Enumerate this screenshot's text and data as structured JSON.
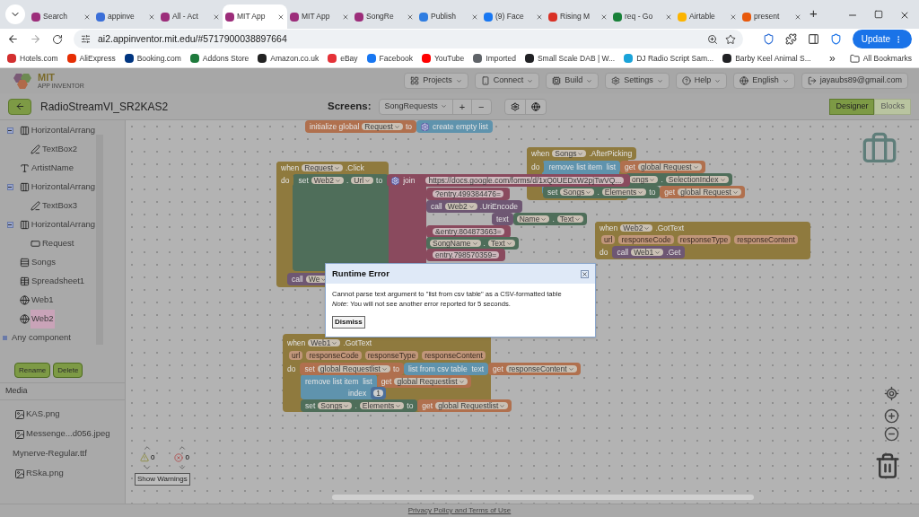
{
  "browser": {
    "tabs": [
      {
        "title": "Search",
        "selected": false,
        "color": "#9c2d7a"
      },
      {
        "title": "appinve",
        "selected": false,
        "color": "#3b6fd8"
      },
      {
        "title": "All - Act",
        "selected": false,
        "color": "#9c2d7a"
      },
      {
        "title": "MIT App",
        "selected": true,
        "color": "#9c2d7a"
      },
      {
        "title": "MIT App",
        "selected": false,
        "color": "#9c2d7a"
      },
      {
        "title": "SongRe",
        "selected": false,
        "color": "#9c2d7a"
      },
      {
        "title": "Publish",
        "selected": false,
        "color": "#2f7de1"
      },
      {
        "title": "(9) Face",
        "selected": false,
        "color": "#1877f2"
      },
      {
        "title": "Rising M",
        "selected": false,
        "color": "#d93025"
      },
      {
        "title": "req - Go",
        "selected": false,
        "color": "#188038"
      },
      {
        "title": "Airtable",
        "selected": false,
        "color": "#fcb400"
      },
      {
        "title": "present",
        "selected": false,
        "color": "#e8590c"
      }
    ],
    "new_tab": "+",
    "address": "ai2.appinventor.mit.edu/#5717900038897664",
    "update_button": "Update",
    "bookmarks": [
      {
        "label": "Hotels.com",
        "color": "#d32f2f"
      },
      {
        "label": "AliExpress",
        "color": "#e62e04"
      },
      {
        "label": "Booking.com",
        "color": "#003580"
      },
      {
        "label": "Addons Store",
        "color": "#1e7a3c"
      },
      {
        "label": "Amazon.co.uk",
        "color": "#222222"
      },
      {
        "label": "eBay",
        "color": "#e53238"
      },
      {
        "label": "Facebook",
        "color": "#1877f2"
      },
      {
        "label": "YouTube",
        "color": "#ff0000"
      },
      {
        "label": "Imported",
        "color": "#5f6368"
      },
      {
        "label": "Small Scale DAB | W...",
        "color": "#202124"
      },
      {
        "label": "DJ Radio Script Sam...",
        "color": "#1aa3d9"
      },
      {
        "label": "Barby Keel Animal S...",
        "color": "#202124"
      }
    ],
    "more": "»",
    "all_bookmarks": "All Bookmarks"
  },
  "app": {
    "logo_title": "MIT",
    "logo_subtitle": "APP INVENTOR",
    "menus": [
      "Projects",
      "Connect",
      "Build",
      "Settings",
      "Help",
      "English",
      "jayaubs89@gmail.com"
    ],
    "project_name": "RadioStreamVI_SR2KAS2",
    "screens_label": "Screens:",
    "screen": "SongRequests",
    "add_screen": "+",
    "remove_screen": "−",
    "views": [
      {
        "label": "Designer",
        "selected": true
      },
      {
        "label": "Blocks",
        "selected": false
      }
    ]
  },
  "components": {
    "items": [
      {
        "label": "HorizontalArrang",
        "kind": "arrangement",
        "expanded": true,
        "selected": false,
        "children": [
          {
            "label": "TextBox2",
            "kind": "textbox",
            "selected": false
          }
        ]
      },
      {
        "label": "ArtistName",
        "kind": "label",
        "selected": false
      },
      {
        "label": "HorizontalArrang",
        "kind": "arrangement",
        "expanded": true,
        "selected": false,
        "children": [
          {
            "label": "TextBox3",
            "kind": "textbox",
            "selected": false
          }
        ]
      },
      {
        "label": "HorizontalArrang",
        "kind": "arrangement",
        "expanded": true,
        "selected": false,
        "children": [
          {
            "label": "Request",
            "kind": "button",
            "selected": false
          }
        ]
      },
      {
        "label": "Songs",
        "kind": "listpicker",
        "selected": false
      },
      {
        "label": "Spreadsheet1",
        "kind": "spreadsheet",
        "selected": false
      },
      {
        "label": "Web1",
        "kind": "web",
        "selected": false
      },
      {
        "label": "Web2",
        "kind": "web",
        "selected": true
      }
    ],
    "any_component": "Any component",
    "buttons": [
      "Rename",
      "Delete"
    ]
  },
  "media": {
    "title": "Media",
    "files": [
      {
        "name": "KAS.png",
        "kind": "image"
      },
      {
        "name": "Messenge...d056.jpeg",
        "kind": "image"
      },
      {
        "name": "Mynerve-Regular.ttf",
        "kind": "font"
      },
      {
        "name": "RSka.png",
        "kind": "image"
      }
    ]
  },
  "blocks": [
    {
      "lines": [
        {
          "kind": "code",
          "segments": [
            {
              "color": "#b0704e",
              "parts": [
                {
                  "kind": "kw",
                  "text": "initialize global"
                },
                {
                  "kind": "dd",
                  "text": "Request"
                },
                {
                  "kind": "kw",
                  "text": "to"
                }
              ]
            },
            {
              "color": "#5f93ad",
              "parts": [
                {
                  "kind": "gear"
                },
                {
                  "kind": "kw",
                  "text": "create empty list"
                }
              ]
            }
          ]
        }
      ]
    },
    {
      "lines": [
        {
          "kind": "code",
          "segments": [
            {
              "color": "#8f7a3e",
              "parts": [
                {
                  "kind": "kw",
                  "text": "when"
                },
                {
                  "kind": "dd",
                  "text": "Request"
                },
                {
                  "kind": "kw",
                  "text": ".Click"
                }
              ]
            }
          ]
        },
        {
          "kind": "code",
          "segments": [
            {
              "color": "#8f7a3e",
              "parts": [
                {
                  "kind": "kw",
                  "text": "do"
                }
              ]
            },
            {
              "color": "#4f6e5a",
              "parts": [
                {
                  "kind": "kw",
                  "text": "set"
                },
                {
                  "kind": "dd",
                  "text": "Web2"
                },
                {
                  "kind": "kw",
                  "text": "."
                },
                {
                  "kind": "dd",
                  "text": "Url"
                },
                {
                  "kind": "kw",
                  "text": "to"
                }
              ]
            },
            {
              "color": "#8a4a5e",
              "parts": [
                {
                  "kind": "gear"
                },
                {
                  "kind": "kw",
                  "text": "join"
                }
              ]
            },
            {
              "color": "#8a4a5e",
              "parts": [
                {
                  "kind": "lit",
                  "text": "https://docs.google.com/forms/d/1xQ0UEDxW2pjTwVQ..."
                }
              ]
            }
          ]
        },
        {
          "kind": "code",
          "segments": [
            {
              "color": "#8a4a5e",
              "parts": [
                {
                  "kind": "lit",
                  "text": "?entry.499384476="
                }
              ]
            }
          ]
        },
        {
          "kind": "code",
          "segments": [
            {
              "color": "#6e5773",
              "parts": [
                {
                  "kind": "kw",
                  "text": "call"
                },
                {
                  "kind": "dd",
                  "text": "Web2"
                },
                {
                  "kind": "kw",
                  "text": ".UriEncode"
                }
              ]
            }
          ]
        },
        {
          "kind": "code",
          "segments": [
            {
              "color": "#6e5773",
              "parts": [
                {
                  "kind": "kw",
                  "text": "text"
                }
              ]
            },
            {
              "color": "#4f6e5a",
              "parts": [
                {
                  "kind": "dd",
                  "text": "Name"
                },
                {
                  "kind": "kw",
                  "text": "."
                },
                {
                  "kind": "dd",
                  "text": "Text"
                }
              ]
            }
          ]
        },
        {
          "kind": "code",
          "segments": [
            {
              "color": "#8a4a5e",
              "parts": [
                {
                  "kind": "lit",
                  "text": "&entry.804873663="
                }
              ]
            }
          ]
        },
        {
          "kind": "code",
          "segments": [
            {
              "color": "#4f6e5a",
              "parts": [
                {
                  "kind": "dd",
                  "text": "SongName"
                },
                {
                  "kind": "kw",
                  "text": "."
                },
                {
                  "kind": "dd",
                  "text": "Text"
                }
              ]
            }
          ]
        },
        {
          "kind": "code",
          "segments": [
            {
              "color": "#8a4a5e",
              "parts": [
                {
                  "kind": "lit",
                  "text": "entry.798570359="
                }
              ]
            }
          ]
        },
        {
          "kind": "code",
          "segments": [
            {
              "color": "#6e5773",
              "parts": [
                {
                  "kind": "kw",
                  "text": "call"
                },
                {
                  "kind": "dd",
                  "text": "We"
                }
              ]
            }
          ]
        }
      ]
    },
    {
      "lines": [
        {
          "kind": "code",
          "segments": [
            {
              "color": "#8f7a3e",
              "parts": [
                {
                  "kind": "kw",
                  "text": "when"
                },
                {
                  "kind": "dd",
                  "text": "Songs"
                },
                {
                  "kind": "kw",
                  "text": ".AfterPicking"
                }
              ]
            }
          ]
        },
        {
          "kind": "code",
          "segments": [
            {
              "color": "#8f7a3e",
              "parts": [
                {
                  "kind": "kw",
                  "text": "do"
                }
              ]
            },
            {
              "color": "#5f93ad",
              "parts": [
                {
                  "kind": "kw",
                  "text": "remove list item  list"
                }
              ]
            },
            {
              "color": "#b0704e",
              "parts": [
                {
                  "kind": "kw",
                  "text": "get"
                },
                {
                  "kind": "dd",
                  "text": "global Request"
                }
              ]
            }
          ]
        },
        {
          "kind": "code",
          "segments": [
            {
              "color": "#4f6e5a",
              "parts": [
                {
                  "kind": "dd",
                  "text": "ongs"
                },
                {
                  "kind": "kw",
                  "text": "."
                },
                {
                  "kind": "dd",
                  "text": "SelectionIndex"
                }
              ]
            }
          ]
        },
        {
          "kind": "code",
          "segments": [
            {
              "color": "#4f6e5a",
              "parts": [
                {
                  "kind": "kw",
                  "text": "set"
                },
                {
                  "kind": "dd",
                  "text": "Songs"
                },
                {
                  "kind": "kw",
                  "text": "."
                },
                {
                  "kind": "dd",
                  "text": "Elements"
                },
                {
                  "kind": "kw",
                  "text": "to"
                }
              ]
            },
            {
              "color": "#b0704e",
              "parts": [
                {
                  "kind": "kw",
                  "text": "get"
                },
                {
                  "kind": "dd",
                  "text": "global Request"
                }
              ]
            }
          ]
        }
      ]
    },
    {
      "lines": [
        {
          "kind": "code",
          "segments": [
            {
              "color": "#8f7a3e",
              "parts": [
                {
                  "kind": "kw",
                  "text": "when"
                },
                {
                  "kind": "dd",
                  "text": "Web2"
                },
                {
                  "kind": "kw",
                  "text": ".GotText"
                }
              ]
            }
          ]
        },
        {
          "kind": "params",
          "params": [
            "url",
            "responseCode",
            "responseType",
            "responseContent"
          ]
        },
        {
          "kind": "code",
          "segments": [
            {
              "color": "#8f7a3e",
              "parts": [
                {
                  "kind": "kw",
                  "text": "do"
                }
              ]
            },
            {
              "color": "#6e5773",
              "parts": [
                {
                  "kind": "kw",
                  "text": "call"
                },
                {
                  "kind": "dd",
                  "text": "Web1"
                },
                {
                  "kind": "kw",
                  "text": ".Get"
                }
              ]
            }
          ]
        }
      ]
    },
    {
      "lines": [
        {
          "kind": "code",
          "segments": [
            {
              "color": "#8f7a3e",
              "parts": [
                {
                  "kind": "kw",
                  "text": "when"
                },
                {
                  "kind": "dd",
                  "text": "Web1"
                },
                {
                  "kind": "kw",
                  "text": ".GotText"
                }
              ]
            }
          ]
        },
        {
          "kind": "params",
          "params": [
            "url",
            "responseCode",
            "responseType",
            "responseContent"
          ]
        },
        {
          "kind": "code",
          "segments": [
            {
              "color": "#8f7a3e",
              "parts": [
                {
                  "kind": "kw",
                  "text": "do"
                }
              ]
            },
            {
              "color": "#b0704e",
              "parts": [
                {
                  "kind": "kw",
                  "text": "set"
                },
                {
                  "kind": "dd",
                  "text": "global Requestlist"
                },
                {
                  "kind": "kw",
                  "text": "to"
                }
              ]
            },
            {
              "color": "#5f93ad",
              "parts": [
                {
                  "kind": "kw",
                  "text": "list from csv table  text"
                }
              ]
            },
            {
              "color": "#b0704e",
              "parts": [
                {
                  "kind": "kw",
                  "text": "get"
                },
                {
                  "kind": "dd",
                  "text": "responseContent"
                }
              ]
            }
          ]
        },
        {
          "kind": "code",
          "segments": [
            {
              "color": "#5f93ad",
              "parts": [
                {
                  "kind": "kw",
                  "text": "remove list item  list"
                }
              ]
            },
            {
              "color": "#b0704e",
              "parts": [
                {
                  "kind": "kw",
                  "text": "get"
                },
                {
                  "kind": "dd",
                  "text": "global Requestlist"
                }
              ]
            }
          ]
        },
        {
          "kind": "code",
          "segments": [
            {
              "color": "#5f93ad",
              "parts": [
                {
                  "kind": "kw",
                  "text": "index"
                }
              ]
            },
            {
              "color": "#4c6f9a",
              "parts": [
                {
                  "kind": "num",
                  "text": "1"
                }
              ]
            }
          ]
        },
        {
          "kind": "code",
          "segments": [
            {
              "color": "#4f6e5a",
              "parts": [
                {
                  "kind": "kw",
                  "text": "set"
                },
                {
                  "kind": "dd",
                  "text": "Songs"
                },
                {
                  "kind": "kw",
                  "text": "."
                },
                {
                  "kind": "dd",
                  "text": "Elements"
                },
                {
                  "kind": "kw",
                  "text": "to"
                }
              ]
            },
            {
              "color": "#b0704e",
              "parts": [
                {
                  "kind": "kw",
                  "text": "get"
                },
                {
                  "kind": "dd",
                  "text": "global Requestlist"
                }
              ]
            }
          ]
        }
      ]
    }
  ],
  "warnings": {
    "warning_count": "0",
    "error_count": "0",
    "button": "Show Warnings"
  },
  "dialog": {
    "title": "Runtime Error",
    "message": "Cannot parse text argument to \"list from csv table\" as a CSV-formatted table",
    "note": "*Note*: You will not see another error reported for 5 seconds.",
    "button": "Dismiss"
  },
  "footer": {
    "link": "Privacy Policy and Terms of Use"
  }
}
